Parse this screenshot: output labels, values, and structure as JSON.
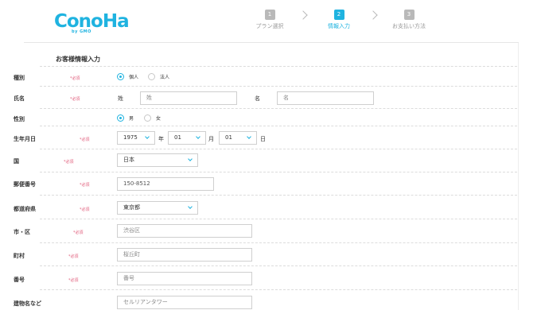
{
  "header": {
    "logo": "ConoHa",
    "logo_sub": "by GMO",
    "steps": [
      {
        "num": "1",
        "label": "プラン選択"
      },
      {
        "num": "2",
        "label": "情報入力"
      },
      {
        "num": "3",
        "label": "お支払い方法"
      }
    ],
    "active_step": 2
  },
  "form": {
    "section_title": "お客様情報入力",
    "required_mark": "*必須",
    "type": {
      "label": "種別",
      "options": [
        "個人",
        "法人"
      ],
      "selected": "個人"
    },
    "name": {
      "label": "氏名",
      "last_label": "姓",
      "last_placeholder": "姓",
      "first_label": "名",
      "first_placeholder": "名"
    },
    "gender": {
      "label": "性別",
      "options": [
        "男",
        "女"
      ],
      "selected": "男"
    },
    "birth": {
      "label": "生年月日",
      "year": "1975",
      "year_unit": "年",
      "month": "01",
      "month_unit": "月",
      "day": "01",
      "day_unit": "日"
    },
    "country": {
      "label": "国",
      "value": "日本"
    },
    "postal": {
      "label": "郵便番号",
      "value": "150-8512"
    },
    "prefecture": {
      "label": "都道府県",
      "value": "東京都"
    },
    "city": {
      "label": "市・区",
      "placeholder": "渋谷区"
    },
    "town": {
      "label": "町村",
      "placeholder": "桜丘町"
    },
    "number": {
      "label": "番号",
      "placeholder": "番号"
    },
    "building": {
      "label": "建物名など",
      "placeholder": "セルリアンタワー"
    }
  }
}
